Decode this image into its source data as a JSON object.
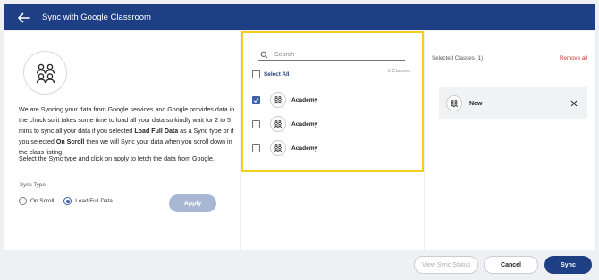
{
  "header": {
    "title": "Sync with Google Classroom"
  },
  "left": {
    "desc_part1": "We are Syncing your data from Google services and Google provides data in the chuck so it takes some time to load all your data so kindly wait for 2 to 5 mins to sync all your data if you selected ",
    "desc_bold1": "Load Full Data",
    "desc_part2": " as a Sync type or if you selected ",
    "desc_bold2": "On Scroll",
    "desc_part3": " then we will Sync your data when you scroll down in the class listing.",
    "desc2": "Select the Sync type and click on apply to fetch the data from Google.",
    "sync_type_label": "Sync Type",
    "options": [
      {
        "label": "On Scroll",
        "selected": false
      },
      {
        "label": "Load Full Data",
        "selected": true
      }
    ],
    "apply_label": "Apply"
  },
  "middle": {
    "search_placeholder": "Search",
    "select_all_label": "Select All",
    "count_text": "3 Classes",
    "classes": [
      {
        "name": "Academy",
        "checked": true
      },
      {
        "name": "Academy",
        "checked": false
      },
      {
        "name": "Academy",
        "checked": false
      }
    ]
  },
  "right": {
    "header": "Selected Classes (1)",
    "remove_all": "Remove all",
    "selected": [
      {
        "name": "New"
      }
    ]
  },
  "footer": {
    "view_sync_status": "View Sync Status",
    "cancel": "Cancel",
    "sync": "Sync"
  },
  "colors": {
    "primary": "#1e3f83",
    "highlight": "#f2cf1f",
    "danger": "#c0392b",
    "apply_disabled": "#a7b7d4"
  }
}
